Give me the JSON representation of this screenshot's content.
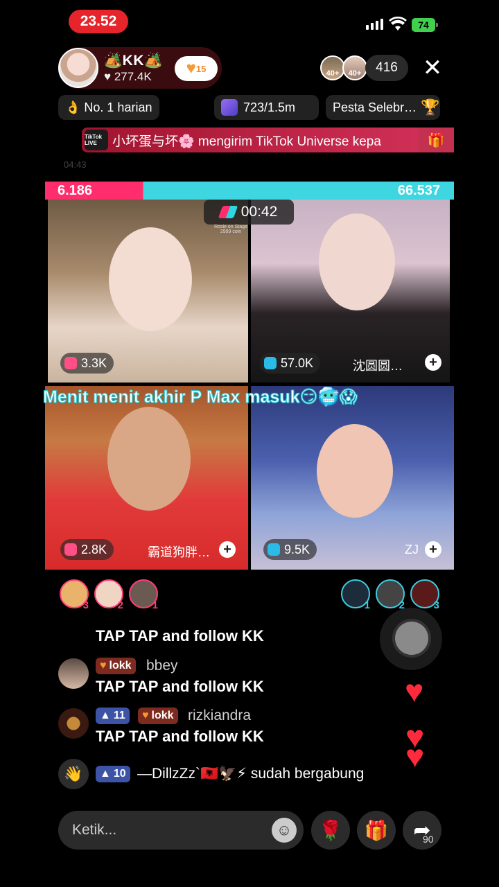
{
  "status_bar": {
    "time": "23.52",
    "battery": "74"
  },
  "host": {
    "name": "🏕️KK🏕️",
    "likes": "♥ 277.4K",
    "fan_level": "15"
  },
  "viewers": {
    "avatar1_level": "40+",
    "avatar2_level": "40+",
    "count": "416"
  },
  "pills": {
    "daily_rank": "👌 No. 1 harian",
    "coins": "723/1.5m",
    "event": "Pesta Selebr…"
  },
  "banner": {
    "badge": "TikTok LIVE",
    "message": "小坏蛋与坏🌸 mengirim TikTok Universe kepa",
    "ghost_time": "04:43"
  },
  "battle": {
    "left_score": "6.186",
    "right_score": "66.537",
    "timer": "00:42",
    "rosie": "Rosie on Stage 2999 coin"
  },
  "tiles": [
    {
      "score": "3.3K",
      "name": ""
    },
    {
      "score": "57.0K",
      "name": "沈圆圆…"
    },
    {
      "score": "2.8K",
      "name": "霸道狗胖…"
    },
    {
      "score": "9.5K",
      "name": "ZJ"
    }
  ],
  "overlay_text": "Menit menit akhir P Max masuk😏🥶😱",
  "ranks_left": [
    "3",
    "2",
    "1"
  ],
  "ranks_right": [
    "1",
    "2",
    "3"
  ],
  "chat": [
    {
      "text": "TAP TAP and  follow KK"
    },
    {
      "badge": "lokk",
      "user": "bbey",
      "text": "TAP TAP and  follow KK"
    },
    {
      "level": "11",
      "badge": "lokk",
      "user": "rizkiandra",
      "text": "TAP TAP and  follow KK"
    }
  ],
  "join": {
    "level": "10",
    "text": "—DillzZz`🇦🇱🦅⚡ sudah bergabung"
  },
  "input": {
    "placeholder": "Ketik..."
  },
  "share_count": "90"
}
